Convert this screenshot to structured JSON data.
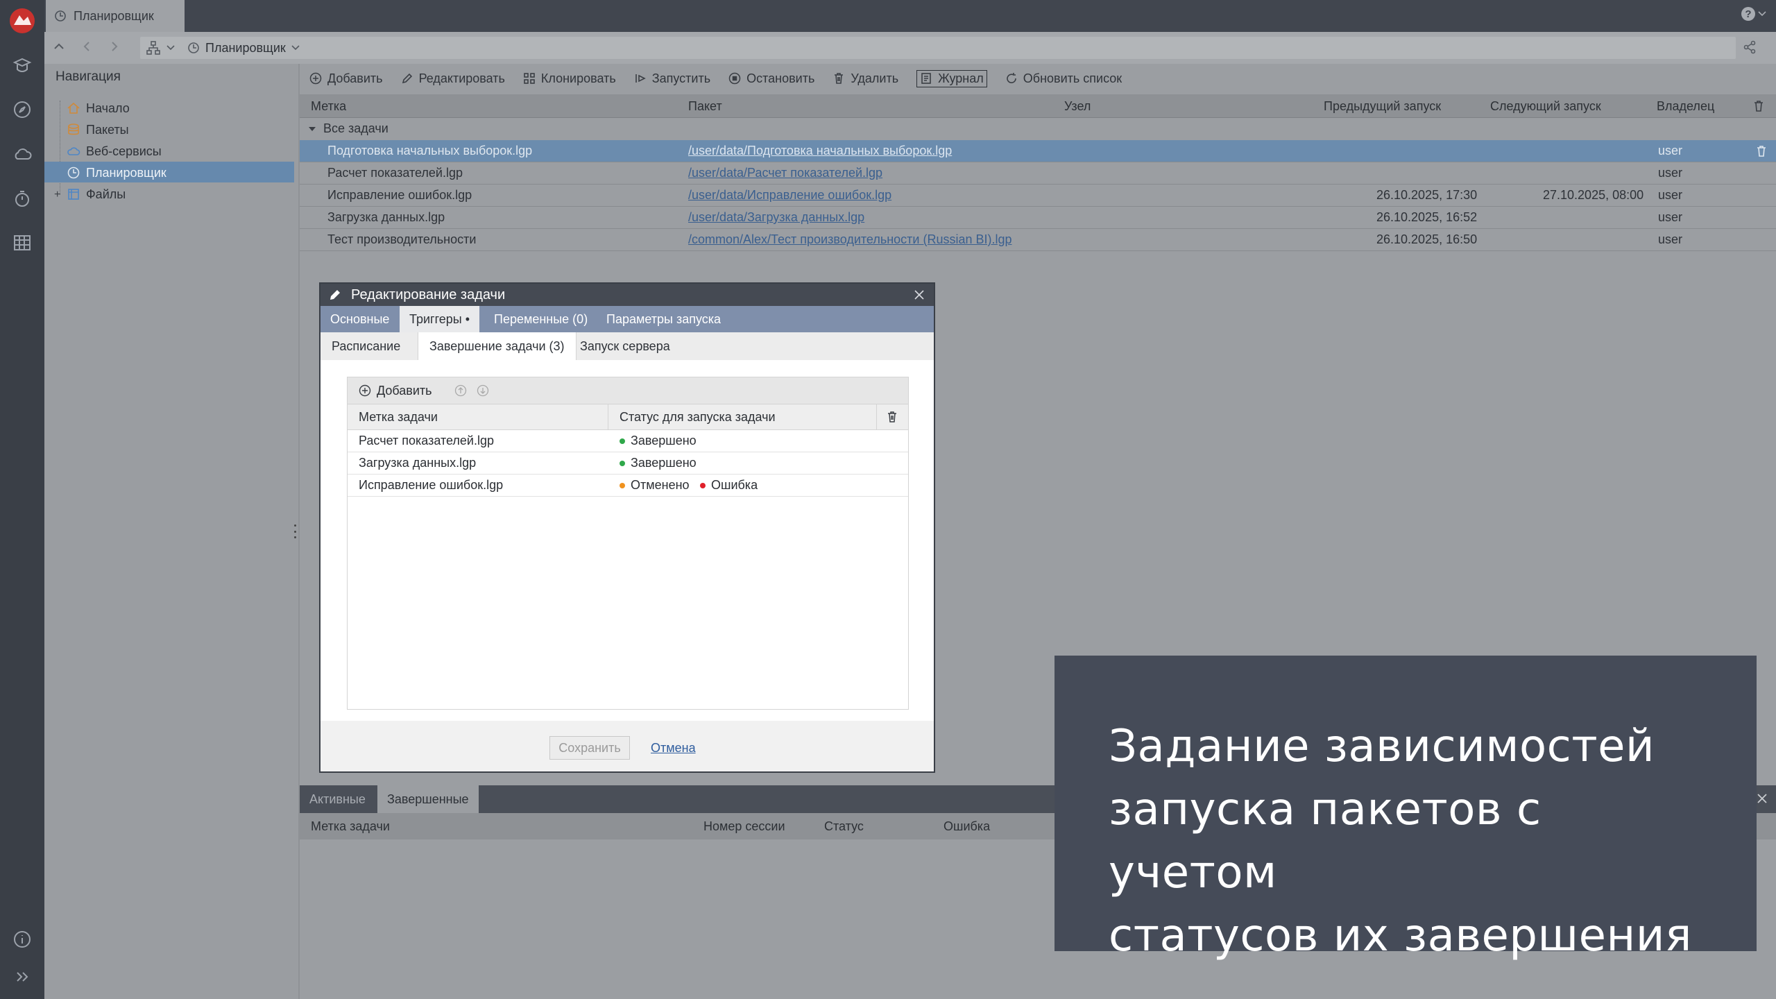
{
  "app": {
    "tab_title": "Планировщик",
    "help_label": "?"
  },
  "address": {
    "breadcrumb": "Планировщик"
  },
  "navigation": {
    "title": "Навигация",
    "items": [
      {
        "label": "Начало",
        "icon": "home-icon"
      },
      {
        "label": "Пакеты",
        "icon": "packages-icon"
      },
      {
        "label": "Веб-сервисы",
        "icon": "cloud-icon"
      },
      {
        "label": "Планировщик",
        "icon": "scheduler-icon",
        "selected": true
      },
      {
        "label": "Файлы",
        "icon": "files-icon",
        "expand": "+"
      }
    ]
  },
  "toolbar": {
    "add": "Добавить",
    "edit": "Редактировать",
    "clone": "Клонировать",
    "run": "Запустить",
    "stop": "Остановить",
    "delete": "Удалить",
    "journal": "Журнал",
    "refresh": "Обновить список"
  },
  "table": {
    "columns": [
      "Метка",
      "Пакет",
      "Узел",
      "Предыдущий запуск",
      "Следующий запуск",
      "Владелец"
    ],
    "group": "Все задачи",
    "rows": [
      {
        "label": "Подготовка начальных выборок.lgp",
        "package": "/user/data/Подготовка начальных выборок.lgp",
        "node": "",
        "prev": "",
        "next": "",
        "owner": "user",
        "selected": true
      },
      {
        "label": "Расчет показателей.lgp",
        "package": "/user/data/Расчет показателей.lgp",
        "node": "",
        "prev": "",
        "next": "",
        "owner": "user"
      },
      {
        "label": "Исправление ошибок.lgp",
        "package": "/user/data/Исправление ошибок.lgp",
        "node": "",
        "prev": "26.10.2025, 17:30",
        "next": "27.10.2025, 08:00",
        "owner": "user"
      },
      {
        "label": "Загрузка данных.lgp",
        "package": "/user/data/Загрузка данных.lgp",
        "node": "",
        "prev": "26.10.2025, 16:52",
        "next": "",
        "owner": "user"
      },
      {
        "label": "Тест производительности",
        "package": "/common/Alex/Тест производительности (Russian BI).lgp",
        "node": "",
        "prev": "26.10.2025, 16:50",
        "next": "",
        "owner": "user"
      }
    ]
  },
  "bottom": {
    "tabs": [
      "Активные",
      "Завершенные"
    ],
    "active_tab": "Завершенные",
    "columns": [
      "Метка задачи",
      "Номер сессии",
      "Статус",
      "Ошибка"
    ]
  },
  "dialog": {
    "title": "Редактирование задачи",
    "tabs": [
      "Основные",
      "Триггеры •",
      "Переменные (0)",
      "Параметры запуска"
    ],
    "active_tab": "Триггеры •",
    "subtabs": [
      "Расписание",
      "Завершение задачи (3)",
      "Запуск сервера"
    ],
    "active_subtab": "Завершение задачи (3)",
    "grid": {
      "add_label": "Добавить",
      "columns": [
        "Метка задачи",
        "Статус для запуска задачи"
      ],
      "rows": [
        {
          "task": "Расчет показателей.lgp",
          "statuses": [
            {
              "text": "Завершено",
              "color": "#2fa84a"
            }
          ]
        },
        {
          "task": "Загрузка данных.lgp",
          "statuses": [
            {
              "text": "Завершено",
              "color": "#2fa84a"
            }
          ]
        },
        {
          "task": "Исправление ошибок.lgp",
          "statuses": [
            {
              "text": "Отменено",
              "color": "#f0921e"
            },
            {
              "text": "Ошибка",
              "color": "#e0202a"
            }
          ]
        }
      ]
    },
    "save_label": "Сохранить",
    "cancel_label": "Отмена"
  },
  "caption": {
    "lines": [
      "Задание зависимостей",
      "запуска пакетов с учетом",
      "статусов их завершения"
    ]
  },
  "colors": {
    "selection": "#6b8cae",
    "dialog_tabs": "#7f8fab",
    "caption_bg": "#454b58",
    "link": "#2f5d9e"
  }
}
